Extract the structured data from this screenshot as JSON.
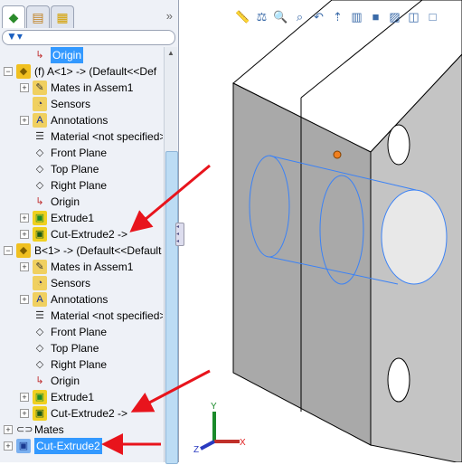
{
  "panel": {
    "tabs": [
      {
        "icon": "feature-manager-icon"
      },
      {
        "icon": "property-manager-icon"
      },
      {
        "icon": "configuration-manager-icon"
      }
    ],
    "more": "»",
    "filter_icon": "filter-icon"
  },
  "tree": [
    {
      "label": "Origin",
      "indent": 1,
      "icon": "origin-icon",
      "selected": true
    },
    {
      "label": "(f) A<1> -> (Default<<Def",
      "indent": 0,
      "icon": "part-icon",
      "expander": "−"
    },
    {
      "label": "Mates in Assem1",
      "indent": 1,
      "icon": "mates-folder-icon",
      "expander": "+"
    },
    {
      "label": "Sensors",
      "indent": 1,
      "icon": "sensors-icon"
    },
    {
      "label": "Annotations",
      "indent": 1,
      "icon": "annotations-icon",
      "expander": "+"
    },
    {
      "label": "Material <not specified>",
      "indent": 1,
      "icon": "material-icon"
    },
    {
      "label": "Front Plane",
      "indent": 1,
      "icon": "plane-icon"
    },
    {
      "label": "Top Plane",
      "indent": 1,
      "icon": "plane-icon"
    },
    {
      "label": "Right Plane",
      "indent": 1,
      "icon": "plane-icon"
    },
    {
      "label": "Origin",
      "indent": 1,
      "icon": "origin-icon"
    },
    {
      "label": "Extrude1",
      "indent": 1,
      "icon": "extrude-icon",
      "expander": "+"
    },
    {
      "label": "Cut-Extrude2 ->",
      "indent": 1,
      "icon": "cut-extrude-icon",
      "expander": "+"
    },
    {
      "label": "B<1> -> (Default<<Default",
      "indent": 0,
      "icon": "part-icon",
      "expander": "−"
    },
    {
      "label": "Mates in Assem1",
      "indent": 1,
      "icon": "mates-folder-icon",
      "expander": "+"
    },
    {
      "label": "Sensors",
      "indent": 1,
      "icon": "sensors-icon"
    },
    {
      "label": "Annotations",
      "indent": 1,
      "icon": "annotations-icon",
      "expander": "+"
    },
    {
      "label": "Material <not specified>",
      "indent": 1,
      "icon": "material-icon"
    },
    {
      "label": "Front Plane",
      "indent": 1,
      "icon": "plane-icon"
    },
    {
      "label": "Top Plane",
      "indent": 1,
      "icon": "plane-icon"
    },
    {
      "label": "Right Plane",
      "indent": 1,
      "icon": "plane-icon"
    },
    {
      "label": "Origin",
      "indent": 1,
      "icon": "origin-icon"
    },
    {
      "label": "Extrude1",
      "indent": 1,
      "icon": "extrude-icon",
      "expander": "+"
    },
    {
      "label": "Cut-Extrude2 ->",
      "indent": 1,
      "icon": "cut-extrude-icon",
      "expander": "+"
    },
    {
      "label": "Mates",
      "indent": 0,
      "icon": "mates-icon",
      "expander": "+"
    },
    {
      "label": "Cut-Extrude2",
      "indent": 0,
      "icon": "assembly-cut-icon",
      "expander": "+",
      "selected": true
    }
  ],
  "toolbar": [
    "measure-icon",
    "mass-properties-icon",
    "zoom-to-fit-icon",
    "zoom-area-icon",
    "previous-view-icon",
    "section-view-icon",
    "view-orientation-icon",
    "shaded-icon",
    "hidden-lines-icon",
    "wireframe-shaded-icon",
    "wireframe-icon"
  ],
  "triad": {
    "x": "X",
    "y": "Y",
    "z": "Z"
  },
  "colors": {
    "selection": "#3399ff",
    "arrow": "#e8141c",
    "sketch": "#3b82f6",
    "face": "#a9a9a9"
  }
}
